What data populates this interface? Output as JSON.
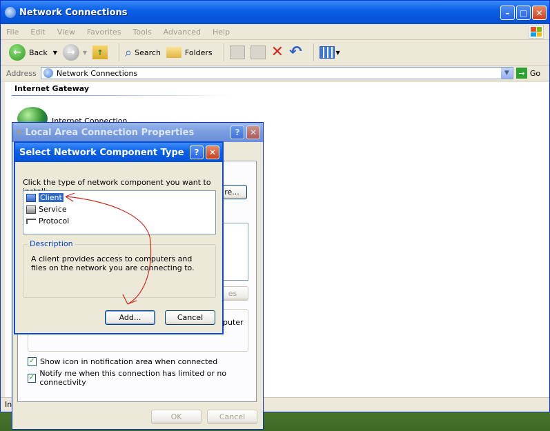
{
  "explorer": {
    "title": "Network Connections",
    "menu": [
      "File",
      "Edit",
      "View",
      "Favorites",
      "Tools",
      "Advanced",
      "Help"
    ],
    "toolbar": {
      "back": "Back",
      "search": "Search",
      "folders": "Folders"
    },
    "address_label": "Address",
    "address_value": "Network Connections",
    "go_label": "Go",
    "group_title": "Internet Gateway",
    "gateway_label": "Internet Connection",
    "status_text": "In"
  },
  "lan_dialog": {
    "title": "Local Area Connection Properties",
    "configure_partial": "re...",
    "button_partial": "es",
    "desc_partial": "puter",
    "show_icon_label": "Show icon in notification area when connected",
    "notify_label": "Notify me when this connection has limited or no connectivity",
    "ok_label": "OK",
    "cancel_label": "Cancel"
  },
  "select_dialog": {
    "title": "Select Network Component Type",
    "prompt": "Click the type of network component you want to install:",
    "items": [
      "Client",
      "Service",
      "Protocol"
    ],
    "selected_item": "Client",
    "description_legend": "Description",
    "description_text": "A client provides access to computers and files on the network you are connecting to.",
    "add_label": "Add...",
    "cancel_label": "Cancel"
  },
  "colors": {
    "accent": "#0553d6",
    "selection": "#316ac5",
    "annotation": "#d22a1e"
  }
}
